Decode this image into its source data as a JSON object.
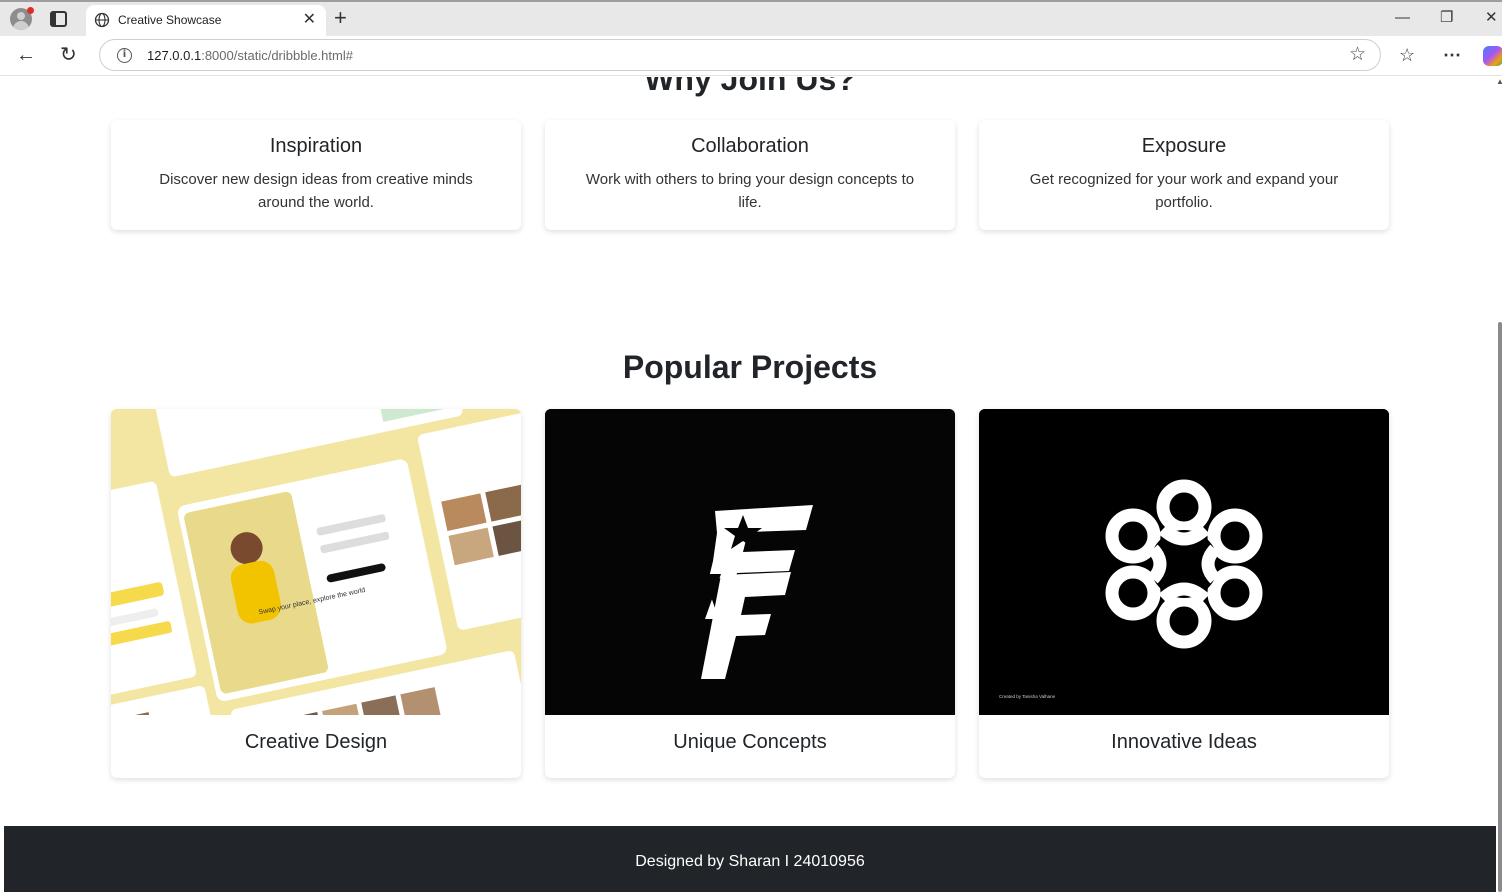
{
  "browser": {
    "tab_title": "Creative Showcase",
    "url_host": "127.0.0.1",
    "url_path": ":8000/static/dribbble.html#",
    "icons": [
      "profile-icon",
      "tabs-icon",
      "globe-icon",
      "close-icon",
      "new-tab-icon",
      "minimize-icon",
      "restore-icon",
      "window-close-icon",
      "back-icon",
      "reload-icon",
      "info-icon",
      "star-icon",
      "favorites-icon",
      "more-icon",
      "copilot-icon"
    ]
  },
  "why": {
    "title": "Why Join Us?",
    "features": [
      {
        "title": "Inspiration",
        "text": "Discover new design ideas from creative minds around the world."
      },
      {
        "title": "Collaboration",
        "text": "Work with others to bring your design concepts to life."
      },
      {
        "title": "Exposure",
        "text": "Get recognized for your work and expand your portfolio."
      }
    ]
  },
  "projects": {
    "title": "Popular Projects",
    "items": [
      {
        "label": "Creative Design",
        "image_text": "Swap your place, explore the world"
      },
      {
        "label": "Unique Concepts"
      },
      {
        "label": "Innovative Ideas",
        "image_caption": "Created by Tanisha Valhane"
      }
    ]
  },
  "footer": {
    "text": "Designed by Sharan I 24010956"
  },
  "colors": {
    "footer_bg": "#212529",
    "card_bg": "#ffffff",
    "text": "#212529",
    "mockup_yellow": "#f7d94c"
  }
}
